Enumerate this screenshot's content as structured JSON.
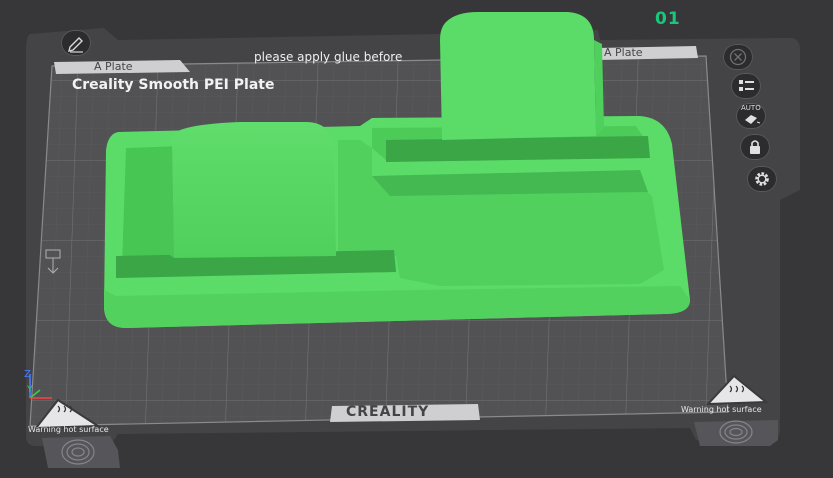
{
  "plate": {
    "number": "01",
    "name": "Creality Smooth PEI Plate",
    "tab_left": "A Plate",
    "tab_right": "A Plate",
    "notice": "please apply glue before",
    "brand": "CREALITY",
    "warning_left": "Warning hot surface",
    "warning_right": "Warning hot surface"
  },
  "toolbar": {
    "auto_label": "AUTO"
  },
  "axes": {
    "z": "Z",
    "y": "Y"
  },
  "colors": {
    "background": "#37373a",
    "plate": "#505052",
    "grid": "#68686b",
    "model": "#5bdb67",
    "accent": "#19c77b"
  }
}
